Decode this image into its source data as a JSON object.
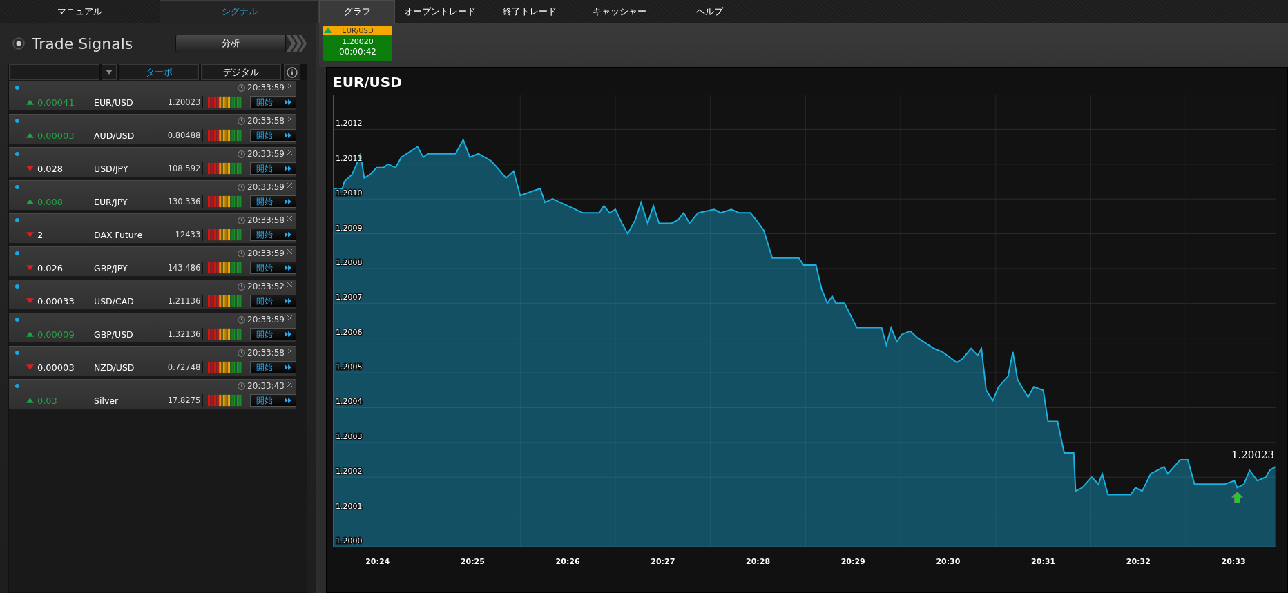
{
  "nav": {
    "left": [
      {
        "label": "マニュアル",
        "selected": false
      },
      {
        "label": "シグナル",
        "selected": true
      }
    ],
    "right": [
      {
        "label": "グラフ",
        "selected": true
      },
      {
        "label": "オープントレード",
        "selected": false
      },
      {
        "label": "終了トレード",
        "selected": false
      },
      {
        "label": "キャッシャー",
        "selected": false
      },
      {
        "label": "ヘルプ",
        "selected": false
      }
    ]
  },
  "signals": {
    "title": "Trade Signals",
    "analysis_button": "分析",
    "filter_tabs": [
      {
        "label": "ターボ",
        "selected": true
      },
      {
        "label": "デジタル",
        "selected": false
      }
    ],
    "rows": [
      {
        "rising": true,
        "change": "0.00041",
        "pair": "EUR/USD",
        "price": "1.20023",
        "time": "20:33:59",
        "button": "開始"
      },
      {
        "rising": true,
        "change": "0.00003",
        "pair": "AUD/USD",
        "price": "0.80488",
        "time": "20:33:58",
        "button": "開始"
      },
      {
        "rising": false,
        "change": "0.028",
        "pair": "USD/JPY",
        "price": "108.592",
        "time": "20:33:59",
        "button": "開始"
      },
      {
        "rising": true,
        "change": "0.008",
        "pair": "EUR/JPY",
        "price": "130.336",
        "time": "20:33:59",
        "button": "開始"
      },
      {
        "rising": false,
        "change": "2",
        "pair": "DAX Future",
        "price": "12433",
        "time": "20:33:58",
        "button": "開始"
      },
      {
        "rising": false,
        "change": "0.026",
        "pair": "GBP/JPY",
        "price": "143.486",
        "time": "20:33:59",
        "button": "開始"
      },
      {
        "rising": false,
        "change": "0.00033",
        "pair": "USD/CAD",
        "price": "1.21136",
        "time": "20:33:52",
        "button": "開始"
      },
      {
        "rising": true,
        "change": "0.00009",
        "pair": "GBP/USD",
        "price": "1.32136",
        "time": "20:33:59",
        "button": "開始"
      },
      {
        "rising": false,
        "change": "0.00003",
        "pair": "NZD/USD",
        "price": "0.72748",
        "time": "20:33:58",
        "button": "開始"
      },
      {
        "rising": true,
        "change": "0.03",
        "pair": "Silver",
        "price": "17.8275",
        "time": "20:33:43",
        "button": "開始"
      }
    ]
  },
  "ticker": {
    "rising": true,
    "symbol": "EUR/USD",
    "price": "1.20020",
    "time": "00:00:42"
  },
  "chart": {
    "chart_data": {
      "type": "area",
      "title": "EUR/USD",
      "x": [
        1223.54,
        1223.63,
        1223.65,
        1223.73,
        1223.78,
        1223.82,
        1223.86,
        1223.92,
        1223.99,
        1224.06,
        1224.11,
        1224.19,
        1224.25,
        1224.42,
        1224.48,
        1224.53,
        1224.67,
        1224.82,
        1224.9,
        1224.97,
        1225.06,
        1225.19,
        1225.26,
        1225.35,
        1225.43,
        1225.5,
        1225.71,
        1225.76,
        1225.84,
        1226.16,
        1226.33,
        1226.38,
        1226.44,
        1226.5,
        1226.57,
        1226.63,
        1226.71,
        1226.77,
        1226.84,
        1226.9,
        1226.96,
        1227.09,
        1227.16,
        1227.22,
        1227.28,
        1227.37,
        1227.54,
        1227.61,
        1227.72,
        1227.8,
        1227.92,
        1227.98,
        1228.06,
        1228.15,
        1228.43,
        1228.48,
        1228.61,
        1228.67,
        1228.73,
        1228.78,
        1228.82,
        1228.91,
        1229.04,
        1229.3,
        1229.35,
        1229.4,
        1229.46,
        1229.51,
        1229.6,
        1229.68,
        1229.85,
        1229.94,
        1230.09,
        1230.15,
        1230.24,
        1230.31,
        1230.35,
        1230.4,
        1230.47,
        1230.53,
        1230.63,
        1230.68,
        1230.73,
        1230.84,
        1230.9,
        1231.0,
        1231.05,
        1231.15,
        1231.22,
        1231.32,
        1231.34,
        1231.41,
        1231.51,
        1231.58,
        1231.62,
        1231.68,
        1231.92,
        1231.97,
        1232.04,
        1232.13,
        1232.27,
        1232.31,
        1232.44,
        1232.52,
        1232.59,
        1232.91,
        1233.01,
        1233.04,
        1233.11,
        1233.17,
        1233.25,
        1233.34,
        1233.38,
        1233.44
      ],
      "grid": true,
      "series": [
        {
          "color": "#1ab0e0",
          "values": [
            1.20103,
            1.20103,
            1.20105,
            1.20107,
            1.2011,
            1.20113,
            1.20106,
            1.20107,
            1.20109,
            1.20109,
            1.2011,
            1.20109,
            1.20112,
            1.20115,
            1.20112,
            1.20113,
            1.20113,
            1.20113,
            1.20117,
            1.20112,
            1.20113,
            1.20111,
            1.20109,
            1.20106,
            1.20108,
            1.20101,
            1.20103,
            1.20099,
            1.201,
            1.20096,
            1.20096,
            1.20098,
            1.20096,
            1.20097,
            1.20093,
            1.2009,
            1.20094,
            1.20099,
            1.20093,
            1.20098,
            1.20093,
            1.20093,
            1.20094,
            1.20096,
            1.20093,
            1.20096,
            1.20097,
            1.20096,
            1.20097,
            1.20096,
            1.20096,
            1.20094,
            1.20091,
            1.20083,
            1.20083,
            1.20081,
            1.20081,
            1.20074,
            1.2007,
            1.20072,
            1.2007,
            1.2007,
            1.20063,
            1.20063,
            1.20058,
            1.20063,
            1.20059,
            1.20061,
            1.20062,
            1.2006,
            1.20057,
            1.20056,
            1.20053,
            1.20054,
            1.20057,
            1.20055,
            1.20057,
            1.20045,
            1.20042,
            1.20046,
            1.20049,
            1.20056,
            1.20048,
            1.20043,
            1.20046,
            1.20045,
            1.20036,
            1.20036,
            1.20027,
            1.20027,
            1.20016,
            1.20017,
            1.2002,
            1.20018,
            1.20021,
            1.20015,
            1.20015,
            1.20017,
            1.20016,
            1.20021,
            1.20023,
            1.20021,
            1.20025,
            1.20025,
            1.20018,
            1.20018,
            1.20019,
            1.20017,
            1.20018,
            1.20022,
            1.20019,
            1.2002,
            1.20022,
            1.20023
          ]
        }
      ],
      "xlim": [
        1223.53,
        1233.45
      ],
      "ylim": [
        1.2,
        1.2013
      ],
      "xticks": [
        {
          "value": 1224,
          "label": "20:24"
        },
        {
          "value": 1225,
          "label": "20:25"
        },
        {
          "value": 1226,
          "label": "20:26"
        },
        {
          "value": 1227,
          "label": "20:27"
        },
        {
          "value": 1228,
          "label": "20:28"
        },
        {
          "value": 1229,
          "label": "20:29"
        },
        {
          "value": 1230,
          "label": "20:30"
        },
        {
          "value": 1231,
          "label": "20:31"
        },
        {
          "value": 1232,
          "label": "20:32"
        },
        {
          "value": 1233,
          "label": "20:33"
        }
      ],
      "yticks": [
        {
          "value": 1.2,
          "label": "1.2000"
        },
        {
          "value": 1.2001,
          "label": "1.2001"
        },
        {
          "value": 1.2002,
          "label": "1.2002"
        },
        {
          "value": 1.2003,
          "label": "1.2003"
        },
        {
          "value": 1.2004,
          "label": "1.2004"
        },
        {
          "value": 1.2005,
          "label": "1.2005"
        },
        {
          "value": 1.2006,
          "label": "1.2006"
        },
        {
          "value": 1.2007,
          "label": "1.2007"
        },
        {
          "value": 1.2008,
          "label": "1.2008"
        },
        {
          "value": 1.2009,
          "label": "1.2009"
        },
        {
          "value": 1.201,
          "label": "1.2010"
        },
        {
          "value": 1.2011,
          "label": "1.2011"
        },
        {
          "value": 1.2012,
          "label": "1.2012"
        }
      ],
      "annotations": [
        "1.20023"
      ]
    },
    "price_rising": true
  }
}
